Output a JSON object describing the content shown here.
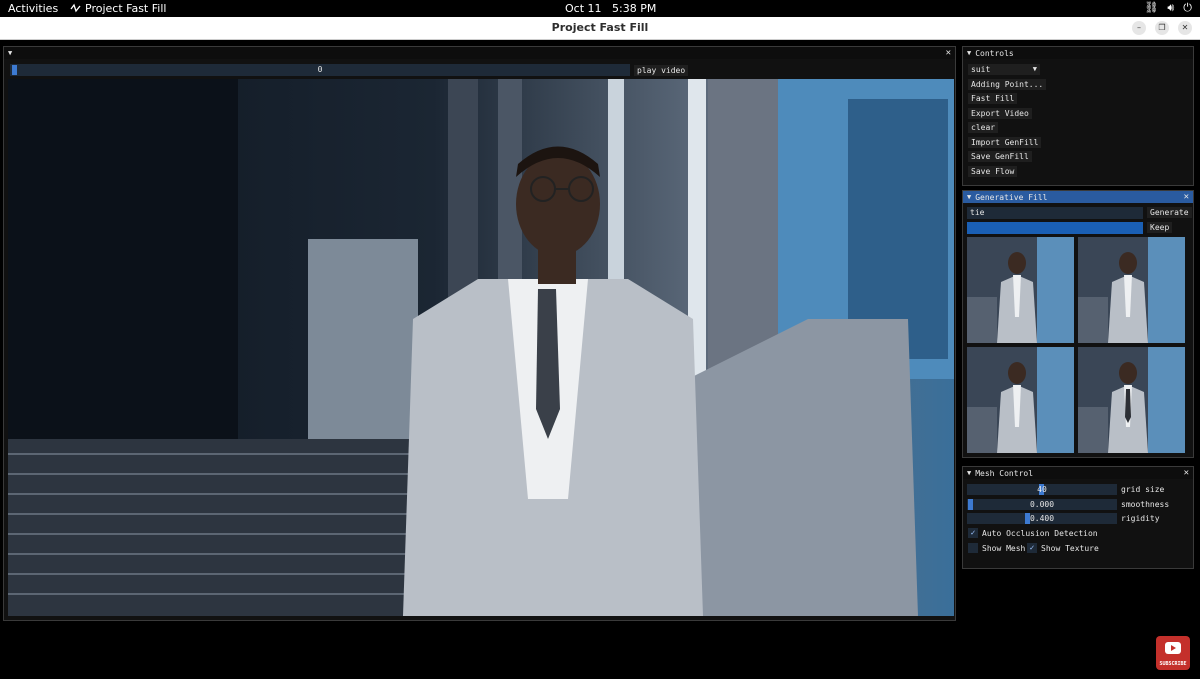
{
  "topbar": {
    "activities": "Activities",
    "app_name": "Project Fast Fill",
    "date": "Oct 11",
    "time": "5:38 PM"
  },
  "window": {
    "title": "Project Fast Fill"
  },
  "video": {
    "frame_value": "0",
    "play_label": "play video",
    "progress_fraction": 0.0
  },
  "controls": {
    "title": "Controls",
    "dropdown_value": "suit",
    "buttons": [
      "Adding Point...",
      "Fast Fill",
      "Export Video",
      "clear",
      "Import GenFill",
      "Save GenFill",
      "Save Flow"
    ]
  },
  "genfill": {
    "title": "Generative Fill",
    "prompt": "tie",
    "generate_label": "Generate",
    "keep_label": "Keep",
    "progress_fraction": 1.0
  },
  "mesh": {
    "title": "Mesh Control",
    "grid_size_value": "40",
    "grid_size_label": "grid size",
    "smoothness_value": "0.000",
    "smoothness_label": "smoothness",
    "rigidity_value": "0.400",
    "rigidity_label": "rigidity",
    "auto_occlusion_label": "Auto Occlusion Detection",
    "auto_occlusion_checked": true,
    "show_mesh_label": "Show Mesh",
    "show_mesh_checked": false,
    "show_texture_label": "Show Texture",
    "show_texture_checked": true
  },
  "subscribe": {
    "label": "SUBSCRIBE"
  },
  "colors": {
    "accent": "#3d7ad1",
    "active_title": "#2a5ba0",
    "progress": "#1a5fb4",
    "subscribe_red": "#c4302b"
  }
}
